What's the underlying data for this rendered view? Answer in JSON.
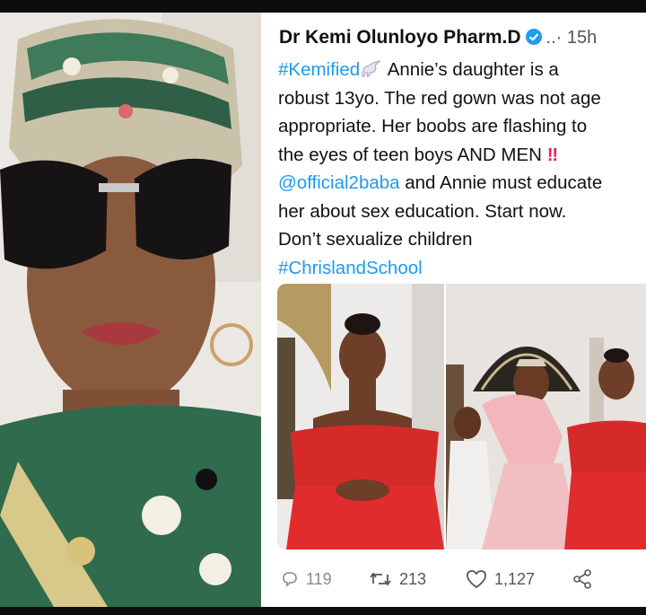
{
  "tweet": {
    "author_name": "Dr Kemi Olunloyo Pharm.D",
    "time_meta": "..· 15h",
    "hashtag1": "#Kemified",
    "line1_rest": " Annie’s daughter is a",
    "line2": "robust 13yo. The red gown was not age",
    "line3": "appropriate. Her boobs are flashing to",
    "line4": "the eyes of teen boys AND MEN ",
    "double_excl": "‼",
    "mention": "@official2baba",
    "line5_rest": " and Annie must educate",
    "line6": "her about sex education. Start now.",
    "line7": "Don’t sexualize children",
    "hashtag2": "#ChrislandSchool"
  },
  "stats": {
    "replies": "119",
    "retweets": "213",
    "likes": "1,127"
  },
  "icons": {
    "verified": "verified-badge-icon",
    "unicorn": "unicorn-emoji-icon",
    "reply": "reply-icon",
    "retweet": "retweet-icon",
    "like": "heart-icon",
    "share": "share-icon"
  },
  "colors": {
    "link": "#1d9bf0",
    "text": "#111111",
    "muted": "#555555",
    "gown_red": "#d62a2a"
  }
}
